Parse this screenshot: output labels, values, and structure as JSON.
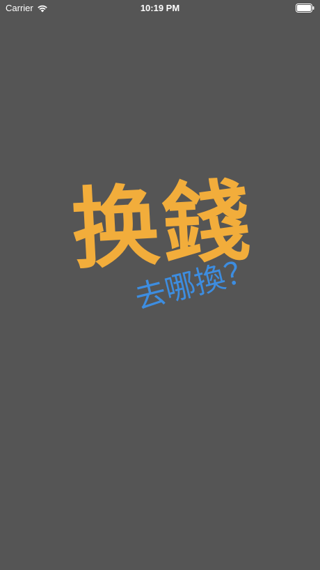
{
  "status_bar": {
    "carrier": "Carrier",
    "time": "10:19 PM",
    "wifi_icon": "wifi-icon",
    "battery_icon": "battery-icon"
  },
  "splash": {
    "title": "换錢",
    "subtitle": "去哪換？",
    "colors": {
      "background": "#555555",
      "title": "#f2ad3b",
      "subtitle": "#3d8de0"
    }
  }
}
